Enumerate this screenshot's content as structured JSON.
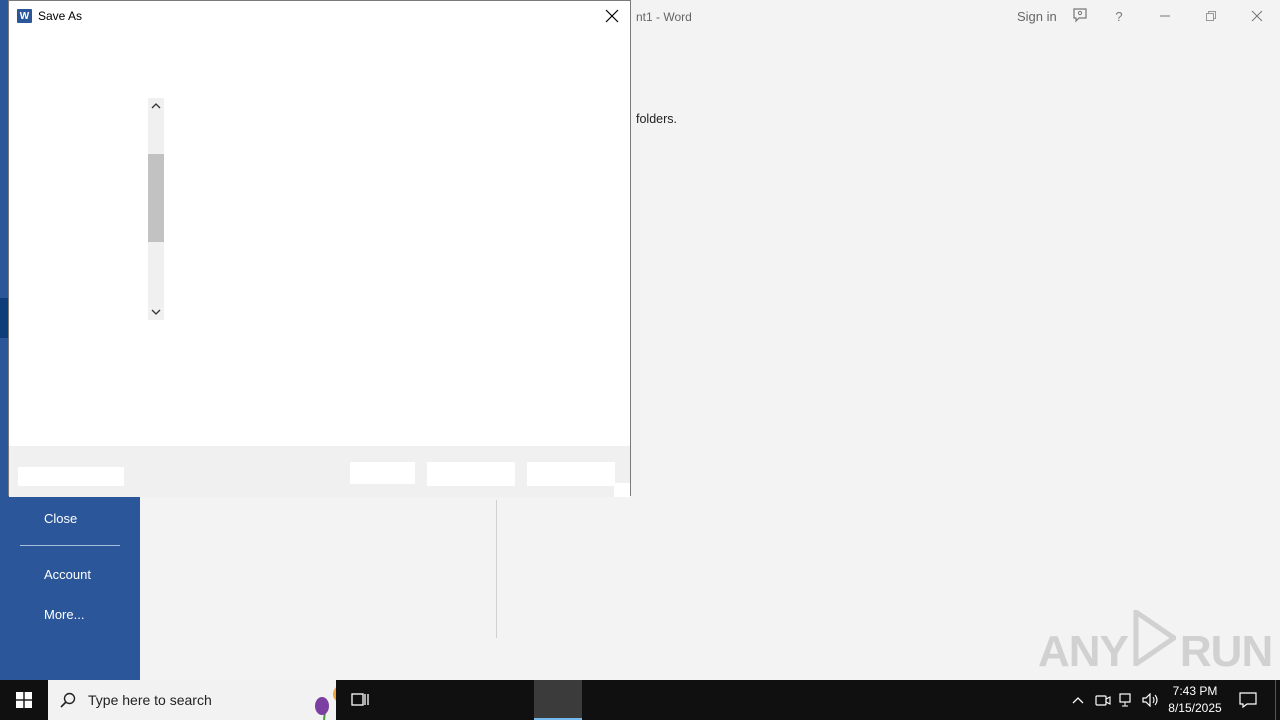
{
  "word": {
    "title_partial": "nt1",
    "title_sep": " - ",
    "app_name": "Word",
    "sign_in": "Sign in",
    "help": "?",
    "body_text": "folders.",
    "rail": {
      "close": "Close",
      "account": "Account",
      "more": "More..."
    }
  },
  "dialog": {
    "title": "Save As",
    "icon_letter": "W"
  },
  "taskbar": {
    "search_placeholder": "Type here to search",
    "time": "7:43 PM",
    "date": "8/15/2025"
  },
  "watermark": {
    "left": "ANY",
    "right": "RUN"
  },
  "colors": {
    "word_blue": "#2b579a",
    "taskbar_bg": "#101010"
  }
}
